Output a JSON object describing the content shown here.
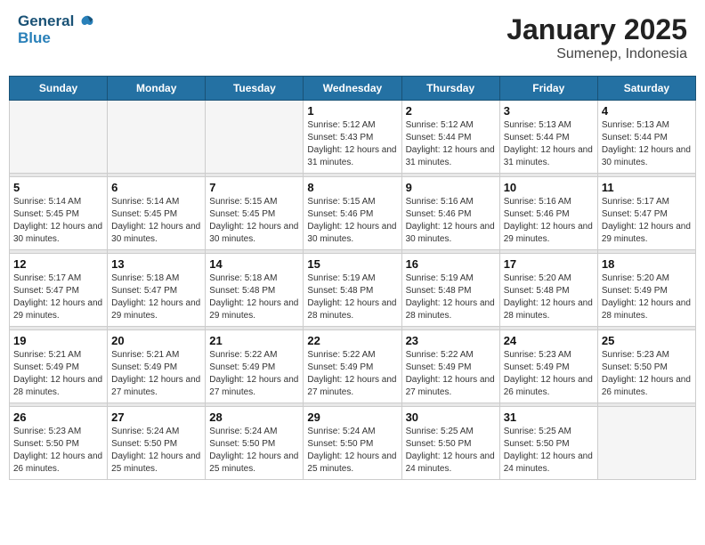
{
  "header": {
    "logo_line1": "General",
    "logo_line2": "Blue",
    "month": "January 2025",
    "location": "Sumenep, Indonesia"
  },
  "days_of_week": [
    "Sunday",
    "Monday",
    "Tuesday",
    "Wednesday",
    "Thursday",
    "Friday",
    "Saturday"
  ],
  "weeks": [
    [
      {
        "day": "",
        "sunrise": "",
        "sunset": "",
        "daylight": "",
        "empty": true
      },
      {
        "day": "",
        "sunrise": "",
        "sunset": "",
        "daylight": "",
        "empty": true
      },
      {
        "day": "",
        "sunrise": "",
        "sunset": "",
        "daylight": "",
        "empty": true
      },
      {
        "day": "1",
        "sunrise": "Sunrise: 5:12 AM",
        "sunset": "Sunset: 5:43 PM",
        "daylight": "Daylight: 12 hours and 31 minutes."
      },
      {
        "day": "2",
        "sunrise": "Sunrise: 5:12 AM",
        "sunset": "Sunset: 5:44 PM",
        "daylight": "Daylight: 12 hours and 31 minutes."
      },
      {
        "day": "3",
        "sunrise": "Sunrise: 5:13 AM",
        "sunset": "Sunset: 5:44 PM",
        "daylight": "Daylight: 12 hours and 31 minutes."
      },
      {
        "day": "4",
        "sunrise": "Sunrise: 5:13 AM",
        "sunset": "Sunset: 5:44 PM",
        "daylight": "Daylight: 12 hours and 30 minutes."
      }
    ],
    [
      {
        "day": "5",
        "sunrise": "Sunrise: 5:14 AM",
        "sunset": "Sunset: 5:45 PM",
        "daylight": "Daylight: 12 hours and 30 minutes."
      },
      {
        "day": "6",
        "sunrise": "Sunrise: 5:14 AM",
        "sunset": "Sunset: 5:45 PM",
        "daylight": "Daylight: 12 hours and 30 minutes."
      },
      {
        "day": "7",
        "sunrise": "Sunrise: 5:15 AM",
        "sunset": "Sunset: 5:45 PM",
        "daylight": "Daylight: 12 hours and 30 minutes."
      },
      {
        "day": "8",
        "sunrise": "Sunrise: 5:15 AM",
        "sunset": "Sunset: 5:46 PM",
        "daylight": "Daylight: 12 hours and 30 minutes."
      },
      {
        "day": "9",
        "sunrise": "Sunrise: 5:16 AM",
        "sunset": "Sunset: 5:46 PM",
        "daylight": "Daylight: 12 hours and 30 minutes."
      },
      {
        "day": "10",
        "sunrise": "Sunrise: 5:16 AM",
        "sunset": "Sunset: 5:46 PM",
        "daylight": "Daylight: 12 hours and 29 minutes."
      },
      {
        "day": "11",
        "sunrise": "Sunrise: 5:17 AM",
        "sunset": "Sunset: 5:47 PM",
        "daylight": "Daylight: 12 hours and 29 minutes."
      }
    ],
    [
      {
        "day": "12",
        "sunrise": "Sunrise: 5:17 AM",
        "sunset": "Sunset: 5:47 PM",
        "daylight": "Daylight: 12 hours and 29 minutes."
      },
      {
        "day": "13",
        "sunrise": "Sunrise: 5:18 AM",
        "sunset": "Sunset: 5:47 PM",
        "daylight": "Daylight: 12 hours and 29 minutes."
      },
      {
        "day": "14",
        "sunrise": "Sunrise: 5:18 AM",
        "sunset": "Sunset: 5:48 PM",
        "daylight": "Daylight: 12 hours and 29 minutes."
      },
      {
        "day": "15",
        "sunrise": "Sunrise: 5:19 AM",
        "sunset": "Sunset: 5:48 PM",
        "daylight": "Daylight: 12 hours and 28 minutes."
      },
      {
        "day": "16",
        "sunrise": "Sunrise: 5:19 AM",
        "sunset": "Sunset: 5:48 PM",
        "daylight": "Daylight: 12 hours and 28 minutes."
      },
      {
        "day": "17",
        "sunrise": "Sunrise: 5:20 AM",
        "sunset": "Sunset: 5:48 PM",
        "daylight": "Daylight: 12 hours and 28 minutes."
      },
      {
        "day": "18",
        "sunrise": "Sunrise: 5:20 AM",
        "sunset": "Sunset: 5:49 PM",
        "daylight": "Daylight: 12 hours and 28 minutes."
      }
    ],
    [
      {
        "day": "19",
        "sunrise": "Sunrise: 5:21 AM",
        "sunset": "Sunset: 5:49 PM",
        "daylight": "Daylight: 12 hours and 28 minutes."
      },
      {
        "day": "20",
        "sunrise": "Sunrise: 5:21 AM",
        "sunset": "Sunset: 5:49 PM",
        "daylight": "Daylight: 12 hours and 27 minutes."
      },
      {
        "day": "21",
        "sunrise": "Sunrise: 5:22 AM",
        "sunset": "Sunset: 5:49 PM",
        "daylight": "Daylight: 12 hours and 27 minutes."
      },
      {
        "day": "22",
        "sunrise": "Sunrise: 5:22 AM",
        "sunset": "Sunset: 5:49 PM",
        "daylight": "Daylight: 12 hours and 27 minutes."
      },
      {
        "day": "23",
        "sunrise": "Sunrise: 5:22 AM",
        "sunset": "Sunset: 5:49 PM",
        "daylight": "Daylight: 12 hours and 27 minutes."
      },
      {
        "day": "24",
        "sunrise": "Sunrise: 5:23 AM",
        "sunset": "Sunset: 5:49 PM",
        "daylight": "Daylight: 12 hours and 26 minutes."
      },
      {
        "day": "25",
        "sunrise": "Sunrise: 5:23 AM",
        "sunset": "Sunset: 5:50 PM",
        "daylight": "Daylight: 12 hours and 26 minutes."
      }
    ],
    [
      {
        "day": "26",
        "sunrise": "Sunrise: 5:23 AM",
        "sunset": "Sunset: 5:50 PM",
        "daylight": "Daylight: 12 hours and 26 minutes."
      },
      {
        "day": "27",
        "sunrise": "Sunrise: 5:24 AM",
        "sunset": "Sunset: 5:50 PM",
        "daylight": "Daylight: 12 hours and 25 minutes."
      },
      {
        "day": "28",
        "sunrise": "Sunrise: 5:24 AM",
        "sunset": "Sunset: 5:50 PM",
        "daylight": "Daylight: 12 hours and 25 minutes."
      },
      {
        "day": "29",
        "sunrise": "Sunrise: 5:24 AM",
        "sunset": "Sunset: 5:50 PM",
        "daylight": "Daylight: 12 hours and 25 minutes."
      },
      {
        "day": "30",
        "sunrise": "Sunrise: 5:25 AM",
        "sunset": "Sunset: 5:50 PM",
        "daylight": "Daylight: 12 hours and 24 minutes."
      },
      {
        "day": "31",
        "sunrise": "Sunrise: 5:25 AM",
        "sunset": "Sunset: 5:50 PM",
        "daylight": "Daylight: 12 hours and 24 minutes."
      },
      {
        "day": "",
        "sunrise": "",
        "sunset": "",
        "daylight": "",
        "empty": true
      }
    ]
  ]
}
